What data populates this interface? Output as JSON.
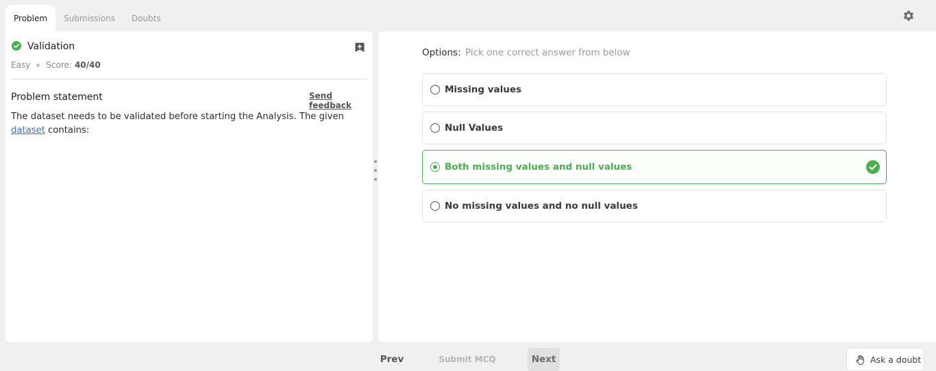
{
  "tabs": [
    {
      "label": "Problem",
      "active": true
    },
    {
      "label": "Submissions",
      "active": false
    },
    {
      "label": "Doubts",
      "active": false
    }
  ],
  "icons": {
    "settings": "gear-icon",
    "bookmark": "bookmark-add-icon",
    "status": "check-circle-icon",
    "correct": "check-circle-icon",
    "ask_doubt": "hand-icon"
  },
  "colors": {
    "success": "#4caf50",
    "link": "#3b6fd6",
    "muted": "#9a9a9a"
  },
  "problem": {
    "title": "Validation",
    "difficulty": "Easy",
    "score_label": "Score:",
    "score_value": "40/40",
    "statement_heading": "Problem statement",
    "feedback_link": "Send feedback",
    "statement_before": "The dataset needs to be validated before starting the Analysis. The given ",
    "statement_link": "dataset",
    "statement_after": " contains:"
  },
  "options": {
    "label": "Options:",
    "hint": "Pick one correct answer from below",
    "items": [
      {
        "label": "Missing values",
        "selected": false
      },
      {
        "label": "Null Values",
        "selected": false
      },
      {
        "label": "Both missing values and null values",
        "selected": true
      },
      {
        "label": "No missing values and no null values",
        "selected": false
      }
    ]
  },
  "footer": {
    "prev": "Prev",
    "submit": "Submit MCQ",
    "next": "Next",
    "ask_doubt": "Ask a doubt"
  }
}
